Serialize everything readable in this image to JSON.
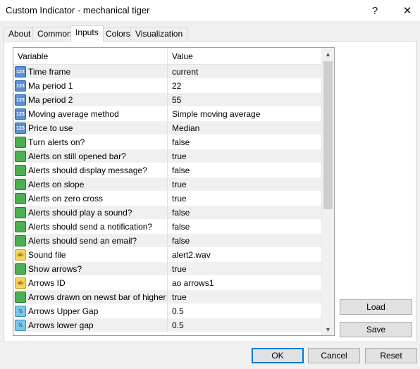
{
  "window": {
    "title": "Custom Indicator - mechanical tiger",
    "help_glyph": "?",
    "close_glyph": "✕"
  },
  "tabs": [
    {
      "label": "About"
    },
    {
      "label": "Common"
    },
    {
      "label": "Inputs",
      "active": true
    },
    {
      "label": "Colors"
    },
    {
      "label": "Visualization"
    }
  ],
  "grid": {
    "header_variable": "Variable",
    "header_value": "Value",
    "rows": [
      {
        "icon": "integer-icon",
        "icon_text": "123",
        "variable": "Time frame",
        "value": "current"
      },
      {
        "icon": "integer-icon",
        "icon_text": "123",
        "variable": "Ma period 1",
        "value": "22"
      },
      {
        "icon": "integer-icon",
        "icon_text": "123",
        "variable": "Ma period 2",
        "value": "55"
      },
      {
        "icon": "integer-icon",
        "icon_text": "123",
        "variable": "Moving average method",
        "value": "Simple moving average"
      },
      {
        "icon": "integer-icon",
        "icon_text": "123",
        "variable": "Price to use",
        "value": "Median"
      },
      {
        "icon": "bool-icon",
        "icon_text": "",
        "variable": "Turn alerts on?",
        "value": "false"
      },
      {
        "icon": "bool-icon",
        "icon_text": "",
        "variable": "Alerts on still opened bar?",
        "value": "true"
      },
      {
        "icon": "bool-icon",
        "icon_text": "",
        "variable": "Alerts should display message?",
        "value": "false"
      },
      {
        "icon": "bool-icon",
        "icon_text": "",
        "variable": "Alerts on slope",
        "value": "true"
      },
      {
        "icon": "bool-icon",
        "icon_text": "",
        "variable": "Alerts on zero cross",
        "value": "true"
      },
      {
        "icon": "bool-icon",
        "icon_text": "",
        "variable": "Alerts should play a sound?",
        "value": "false"
      },
      {
        "icon": "bool-icon",
        "icon_text": "",
        "variable": "Alerts should send a notification?",
        "value": "false"
      },
      {
        "icon": "bool-icon",
        "icon_text": "",
        "variable": "Alerts should send an email?",
        "value": "false"
      },
      {
        "icon": "string-icon",
        "icon_text": "ab",
        "variable": "Sound file",
        "value": "alert2.wav"
      },
      {
        "icon": "bool-icon",
        "icon_text": "",
        "variable": "Show arrows?",
        "value": "true"
      },
      {
        "icon": "string-icon",
        "icon_text": "ab",
        "variable": "Arrows ID",
        "value": "ao arrows1"
      },
      {
        "icon": "bool-icon",
        "icon_text": "",
        "variable": "Arrows drawn on newst bar of higher ti...",
        "value": "true"
      },
      {
        "icon": "double-icon",
        "icon_text": "½",
        "variable": "Arrows Upper Gap",
        "value": "0.5"
      },
      {
        "icon": "double-icon",
        "icon_text": "½",
        "variable": "Arrows lower gap",
        "value": "0.5"
      }
    ]
  },
  "scrollbar": {
    "up_glyph": "▲",
    "down_glyph": "▼"
  },
  "buttons": {
    "load": "Load",
    "save": "Save",
    "ok": "OK",
    "cancel": "Cancel",
    "reset": "Reset"
  },
  "colors": {
    "integer_icon": "#5b8fd0",
    "bool_icon": "#4caf50",
    "string_icon": "#f5d45a",
    "double_icon": "#7cc6e8",
    "default_button_border": "#0078d7"
  }
}
